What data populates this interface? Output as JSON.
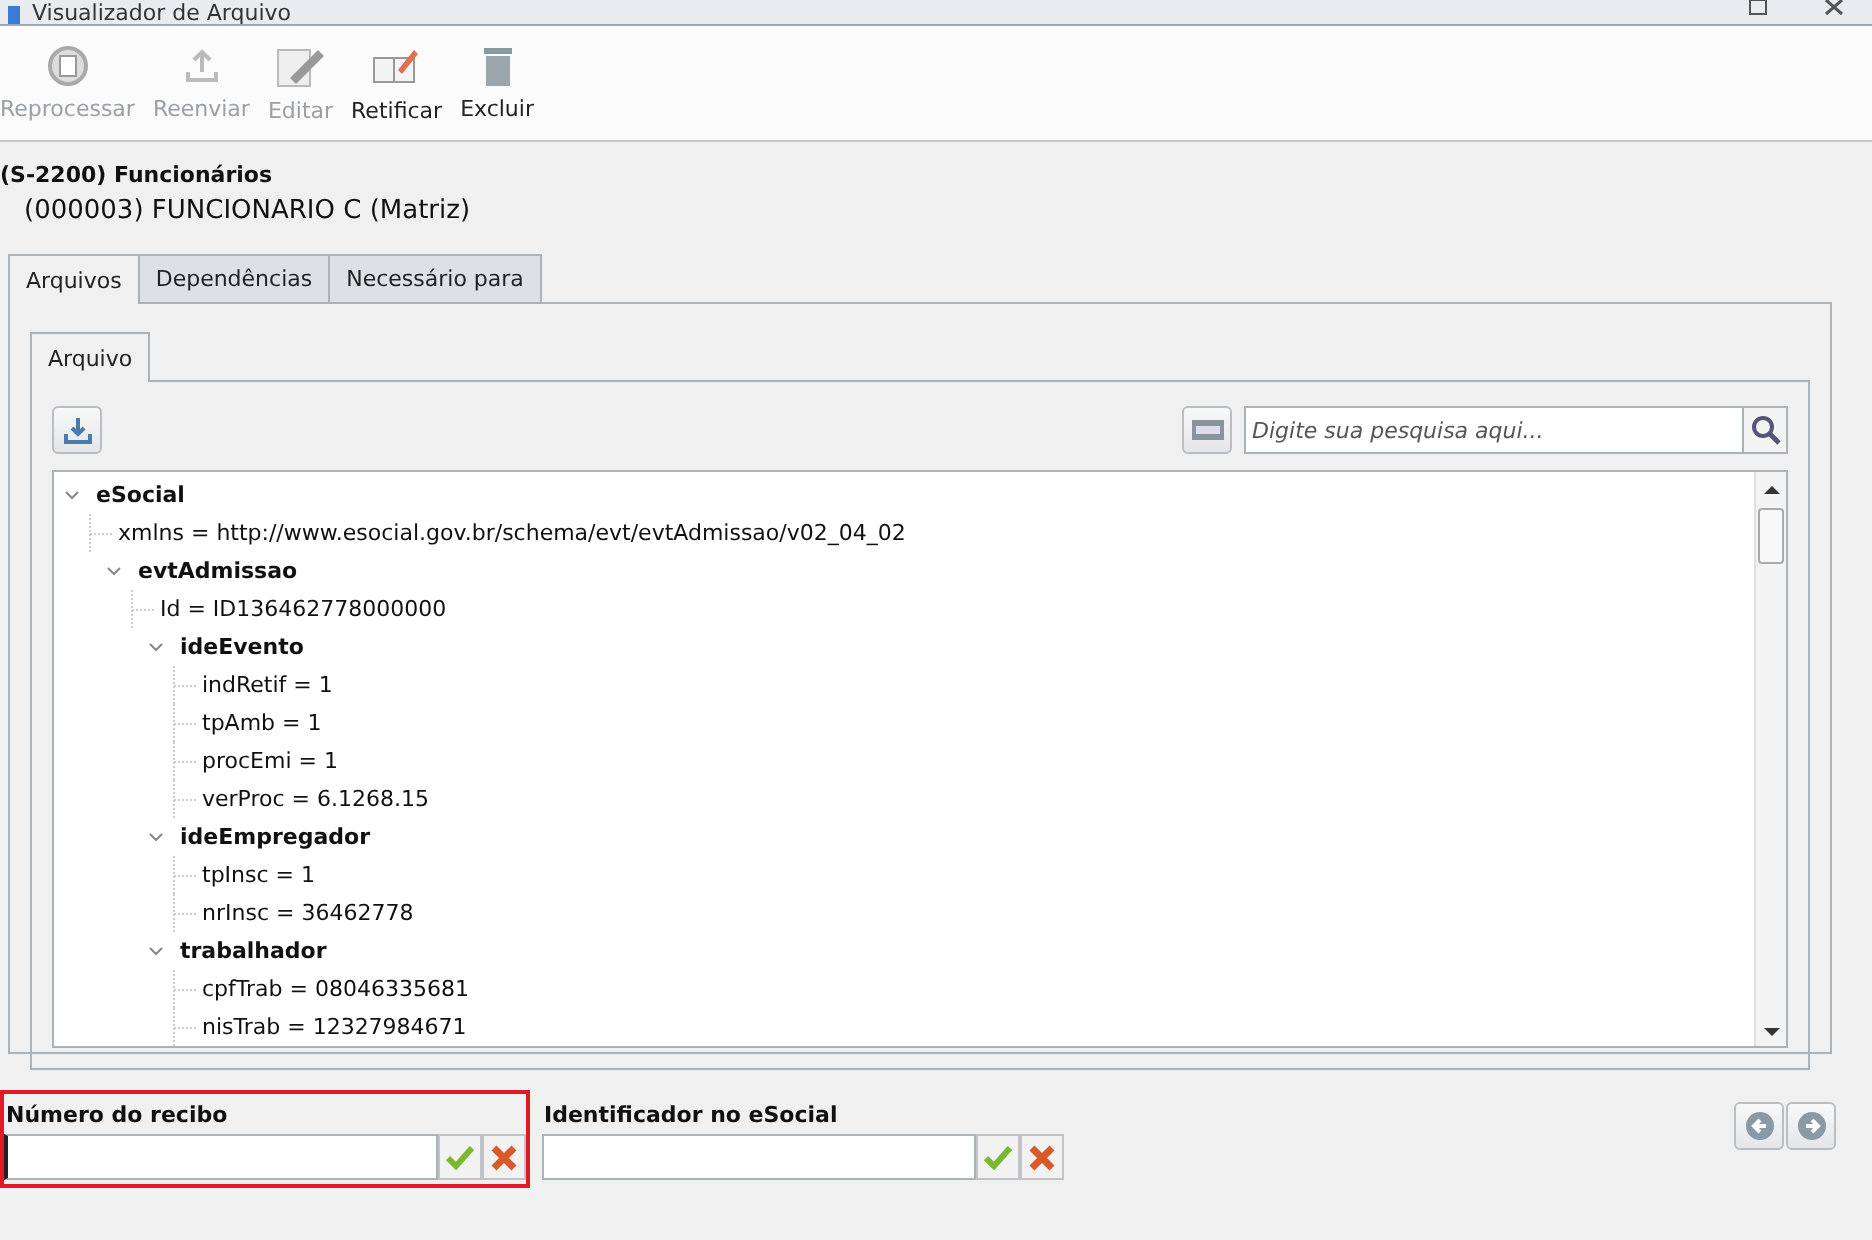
{
  "window": {
    "title": "Visualizador de Arquivo"
  },
  "toolbar": [
    {
      "label": "Reprocessar",
      "kind": "reprocess",
      "disabled": true
    },
    {
      "label": "Reenviar",
      "kind": "upload",
      "disabled": true
    },
    {
      "label": "Editar",
      "kind": "edit",
      "disabled": true
    },
    {
      "label": "Retificar",
      "kind": "rectify",
      "disabled": false
    },
    {
      "label": "Excluir",
      "kind": "delete",
      "disabled": false
    }
  ],
  "header": {
    "event": "(S-2200) Funcionários",
    "employee": "(000003) FUNCIONARIO C (Matriz)"
  },
  "tabs": [
    {
      "label": "Arquivos",
      "selected": true
    },
    {
      "label": "Dependências",
      "selected": false
    },
    {
      "label": "Necessário para",
      "selected": false
    }
  ],
  "inner_tabs": [
    {
      "label": "Arquivo",
      "selected": true
    }
  ],
  "search": {
    "placeholder": "Digite sua pesquisa aqui..."
  },
  "tree": [
    {
      "kind": "element",
      "label": "eSocial",
      "expanded": true,
      "children": [
        {
          "kind": "attribute",
          "label": "xmlns = http://www.esocial.gov.br/schema/evt/evtAdmissao/v02_04_02"
        },
        {
          "kind": "element",
          "label": "evtAdmissao",
          "expanded": true,
          "children": [
            {
              "kind": "attribute",
              "label": "Id = ID136462778000000"
            },
            {
              "kind": "element",
              "label": "ideEvento",
              "expanded": true,
              "children": [
                {
                  "kind": "attribute",
                  "label": "indRetif = 1"
                },
                {
                  "kind": "attribute",
                  "label": "tpAmb = 1"
                },
                {
                  "kind": "attribute",
                  "label": "procEmi = 1"
                },
                {
                  "kind": "attribute",
                  "label": "verProc = 6.1268.15"
                }
              ]
            },
            {
              "kind": "element",
              "label": "ideEmpregador",
              "expanded": true,
              "children": [
                {
                  "kind": "attribute",
                  "label": "tpInsc = 1"
                },
                {
                  "kind": "attribute",
                  "label": "nrInsc = 36462778"
                }
              ]
            },
            {
              "kind": "element",
              "label": "trabalhador",
              "expanded": true,
              "children": [
                {
                  "kind": "attribute",
                  "label": "cpfTrab = 08046335681"
                },
                {
                  "kind": "attribute",
                  "label": "nisTrab = 12327984671"
                }
              ]
            }
          ]
        }
      ]
    }
  ],
  "fields": [
    {
      "label": "Número do recibo",
      "focused": true
    },
    {
      "label": "Identificador no eSocial",
      "focused": false
    }
  ]
}
